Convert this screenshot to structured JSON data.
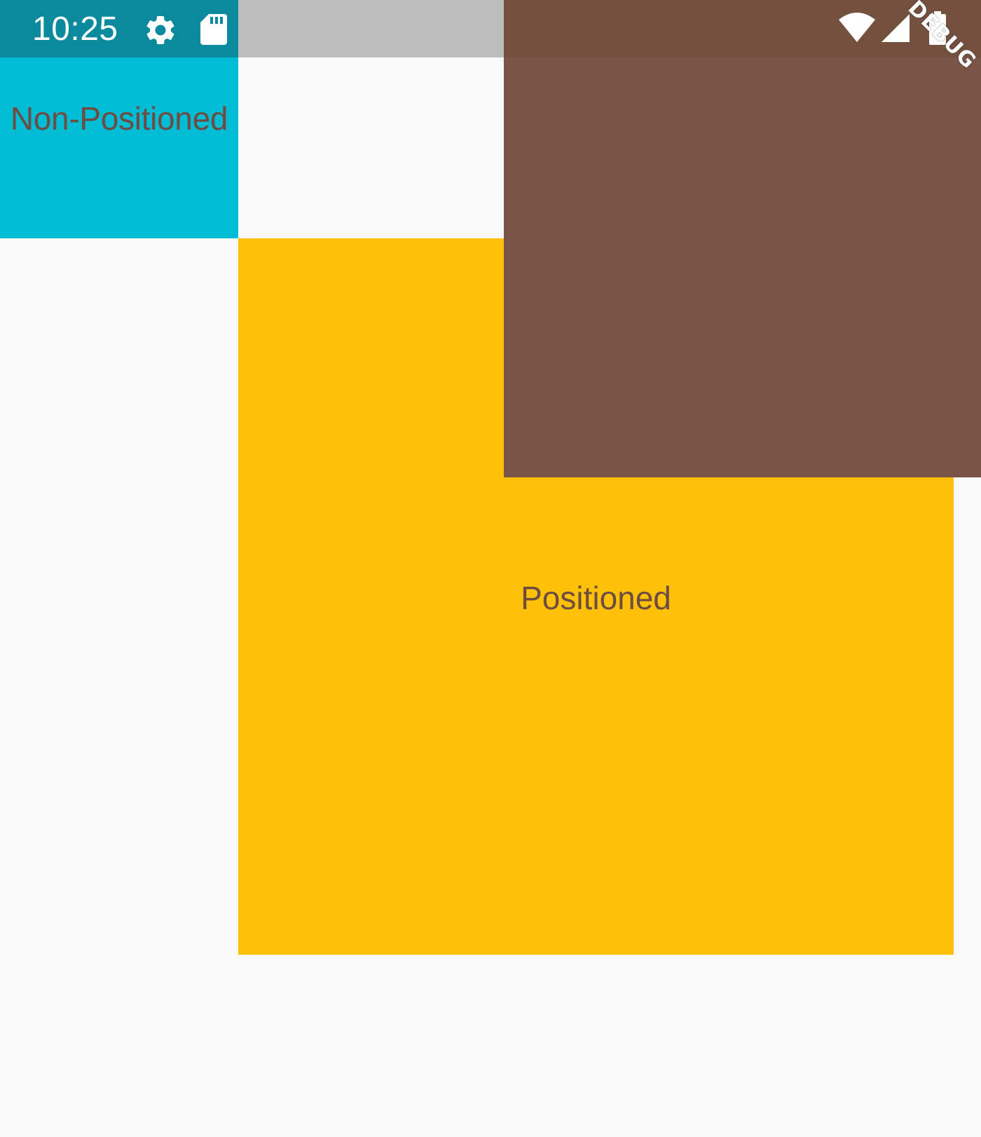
{
  "status_bar": {
    "time": "10:25",
    "icons": [
      "settings-icon",
      "sd-card-icon",
      "wifi-icon",
      "signal-icon",
      "battery-icon"
    ]
  },
  "boxes": {
    "non_positioned": {
      "label": "Non-Positioned",
      "color": "#00bcd4"
    },
    "positioned": {
      "label": "Positioned",
      "color": "#ffc107"
    },
    "brown_box": {
      "color": "#795548"
    }
  },
  "debug_banner": {
    "label": "DEBUG"
  },
  "colors": {
    "background": "#fafafa",
    "status_bar_background": "#bdbdbd",
    "label_text": "#6d4c41"
  }
}
